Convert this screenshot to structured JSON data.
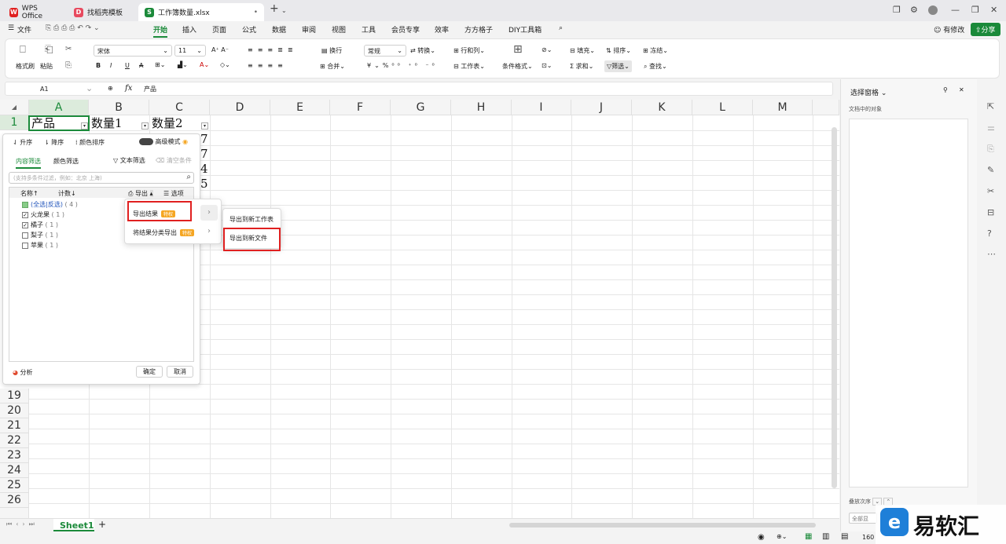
{
  "tabs": [
    {
      "label": "WPS Office",
      "icon": "wps-logo-icon"
    },
    {
      "label": "找稻壳模板",
      "icon": "docer-icon"
    },
    {
      "label": "工作簿数量.xlsx",
      "icon": "spreadsheet-icon"
    }
  ],
  "menubar": {
    "file": "文件",
    "items": [
      "开始",
      "插入",
      "页面",
      "公式",
      "数据",
      "审阅",
      "视图",
      "工具",
      "会员专享",
      "效率",
      "方方格子",
      "DIY工具箱"
    ],
    "active": "开始",
    "changes": "有修改",
    "share": "分享"
  },
  "ribbon": {
    "format_painter": "格式刷",
    "paste": "粘贴",
    "font_name": "宋体",
    "font_size": "11",
    "wrap": "换行",
    "merge": "合并",
    "number_format": "常规",
    "convert": "转换",
    "rows_cols": "行和列",
    "worksheet": "工作表",
    "conditional_format": "条件格式",
    "fill": "填充",
    "sort": "排序",
    "freeze": "冻结",
    "sum": "求和",
    "filter": "筛选",
    "find": "查找"
  },
  "formula_bar": {
    "cell_ref": "A1",
    "fx": "fx",
    "value": "产品"
  },
  "columns": [
    "A",
    "B",
    "C",
    "D",
    "E",
    "F",
    "G",
    "H",
    "I",
    "J",
    "K",
    "L",
    "M"
  ],
  "rows_top": [
    "1"
  ],
  "rows_bottom": [
    "19",
    "20",
    "21",
    "22",
    "23",
    "24",
    "25",
    "26"
  ],
  "cells": {
    "a1": "产品",
    "b1": "数量1",
    "c1": "数量2",
    "c2": "7",
    "c3": "7",
    "c4": "4",
    "c5": "5"
  },
  "filter_panel": {
    "sort_asc": "升序",
    "sort_desc": "降序",
    "color_sort": "颜色排序",
    "advanced": "高级模式",
    "tab_content": "内容筛选",
    "tab_color": "颜色筛选",
    "text_filter": "文本筛选",
    "clear": "清空条件",
    "search_placeholder": "(支持多条件过滤，例如：北京  上海)",
    "col_name": "名称↑",
    "col_count": "计数↓",
    "export": "导出",
    "options": "选项",
    "items": [
      {
        "label": "(全选|反选)",
        "count": "( 4 )",
        "checked": "partial"
      },
      {
        "label": "火龙果",
        "count": "( 1 )",
        "checked": "yes"
      },
      {
        "label": "橘子",
        "count": "( 1 )",
        "checked": "yes"
      },
      {
        "label": "梨子",
        "count": "( 1 )",
        "checked": "no"
      },
      {
        "label": "苹果",
        "count": "( 1 )",
        "checked": "no"
      }
    ],
    "analyze": "分析",
    "ok": "确定",
    "cancel": "取消"
  },
  "export_menu": {
    "export_result": "导出结果",
    "export_by_category": "将结果分类导出",
    "badge": "特权"
  },
  "sub_menu": {
    "to_new_sheet": "导出到新工作表",
    "to_new_file": "导出到新文件"
  },
  "right_panel": {
    "title": "选择窗格",
    "subtitle": "文档中的对象",
    "stack_order": "叠放次序",
    "show_all": "全部显"
  },
  "sheet_tabs": [
    "Sheet1"
  ],
  "status": {
    "zoom": "160"
  },
  "watermark": "易软汇"
}
